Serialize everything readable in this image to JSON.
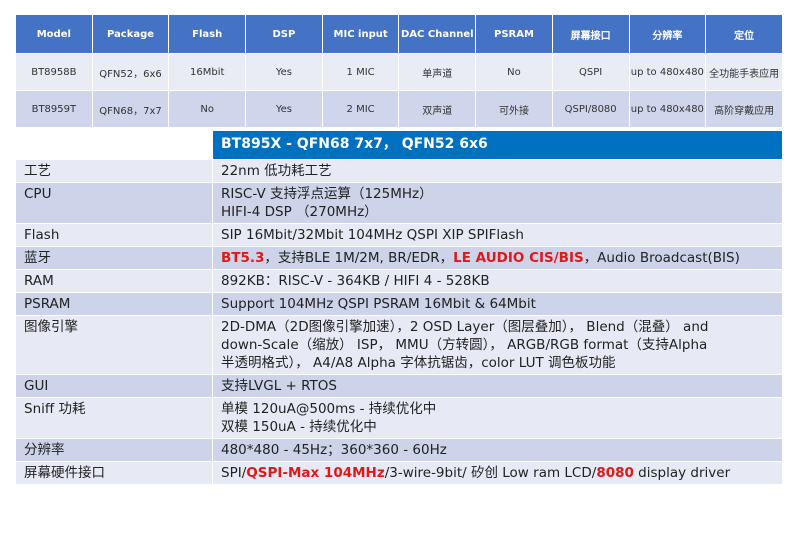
{
  "top_table": {
    "headers": [
      "Model",
      "Package",
      "Flash",
      "DSP",
      "MIC input",
      "DAC Channel",
      "PSRAM",
      "屏幕接口",
      "分辨率",
      "定位"
    ],
    "rows": [
      [
        "BT8958B",
        "QFN52，6x6",
        "16Mbit",
        "Yes",
        "1 MIC",
        "单声道",
        "No",
        "QSPI",
        "up to 480x480",
        "全功能手表应用"
      ],
      [
        "BT8959T",
        "QFN68，7x7",
        "No",
        "Yes",
        "2 MIC",
        "双声道",
        "可外接",
        "QSPI/8080",
        "up to 480x480",
        "高阶穿戴应用"
      ]
    ]
  },
  "spec": {
    "title": "BT895X - QFN68 7x7， QFN52 6x6",
    "rows": {
      "process": {
        "label": "工艺",
        "value": "22nm 低功耗工艺"
      },
      "cpu": {
        "label": "CPU",
        "line1": "RISC-V 支持浮点运算（125MHz）",
        "line2": "HIFI-4 DSP （270MHz）"
      },
      "flash": {
        "label": "Flash",
        "value": "SIP 16Mbit/32Mbit 104MHz QSPI XIP SPIFlash"
      },
      "bt": {
        "label": "蓝牙",
        "p1": "BT5.3",
        "p2": "，支持BLE 1M/2M, BR/EDR，",
        "p3": "LE AUDIO CIS/BIS",
        "p4": "，Audio Broadcast(BIS)"
      },
      "ram": {
        "label": "RAM",
        "value": "892KB：RISC-V - 364KB / HIFI 4 - 528KB"
      },
      "psram": {
        "label": "PSRAM",
        "value": "Support 104MHz QSPI PSRAM 16Mbit & 64Mbit"
      },
      "image": {
        "label": "图像引擎",
        "line1": "2D-DMA（2D图像引擎加速），2 OSD Layer（图层叠加）， Blend（混叠） and",
        "line2": "down-Scale（缩放） ISP， MMU（方转圆）， ARGB/RGB format（支持Alpha",
        "line3": "半透明格式）， A4/A8 Alpha 字体抗锯齿，color LUT 调色板功能"
      },
      "gui": {
        "label": "GUI",
        "value": "支持LVGL + RTOS"
      },
      "sniff": {
        "label": "Sniff 功耗",
        "line1": "单模 120uA@500ms - 持续优化中",
        "line2": "双模 150uA - 持续优化中"
      },
      "resolution": {
        "label": "分辨率",
        "value": "480*480 - 45Hz；360*360 - 60Hz"
      },
      "display": {
        "label": "屏幕硬件接口",
        "p1": "SPI/",
        "p2": "QSPI-Max 104MHz",
        "p3": "/3-wire-9bit/ 矽创 Low ram LCD/",
        "p4": "8080",
        "p5": " display driver"
      }
    }
  }
}
